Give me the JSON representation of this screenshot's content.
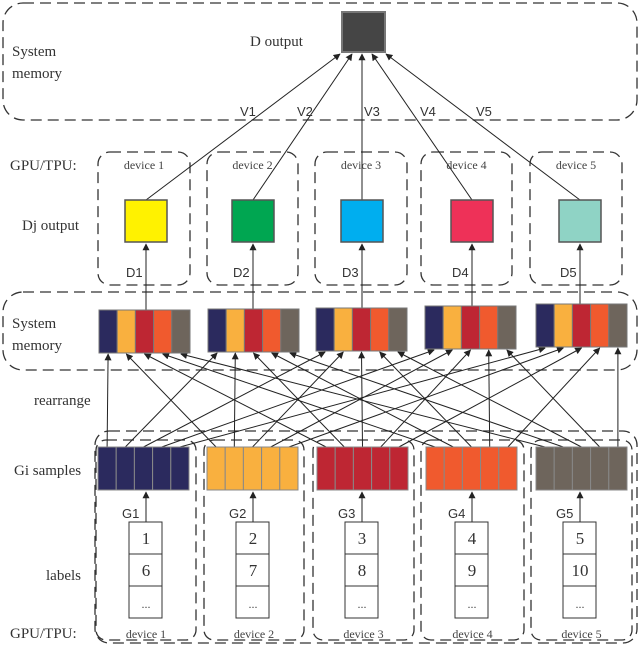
{
  "top": {
    "region_label_1": "System",
    "region_label_2": "memory",
    "output_label": "D output",
    "output_color": "#454545"
  },
  "edge_labels": [
    "V1",
    "V2",
    "V3",
    "V4",
    "V5"
  ],
  "upper_devices": {
    "row_label": "GPU/TPU:",
    "output_row_label": "Dj output",
    "devices": [
      "device 1",
      "device 2",
      "device 3",
      "device 4",
      "device 5"
    ],
    "d_labels": [
      "D1",
      "D2",
      "D3",
      "D4",
      "D5"
    ],
    "output_colors": [
      "#FFF200",
      "#00A651",
      "#00AEEF",
      "#EE3158",
      "#8FD3C5"
    ]
  },
  "middle": {
    "region_label_1": "System",
    "region_label_2": "memory",
    "rearrange_label": "rearrange"
  },
  "generator_colors": [
    "#2B2A5E",
    "#F9B03F",
    "#BE2633",
    "#F05A2E",
    "#6E655C"
  ],
  "lower_devices": {
    "samples_label": "Gi samples",
    "labels_label": "labels",
    "row_label": "GPU/TPU:",
    "devices": [
      "device 1",
      "device 2",
      "device 3",
      "device 4",
      "device 5"
    ],
    "g_labels": [
      "G1",
      "G2",
      "G3",
      "G4",
      "G5"
    ],
    "label_stacks": [
      [
        "1",
        "6",
        "..."
      ],
      [
        "2",
        "7",
        "..."
      ],
      [
        "3",
        "8",
        "..."
      ],
      [
        "4",
        "9",
        "..."
      ],
      [
        "5",
        "10",
        "..."
      ]
    ]
  }
}
